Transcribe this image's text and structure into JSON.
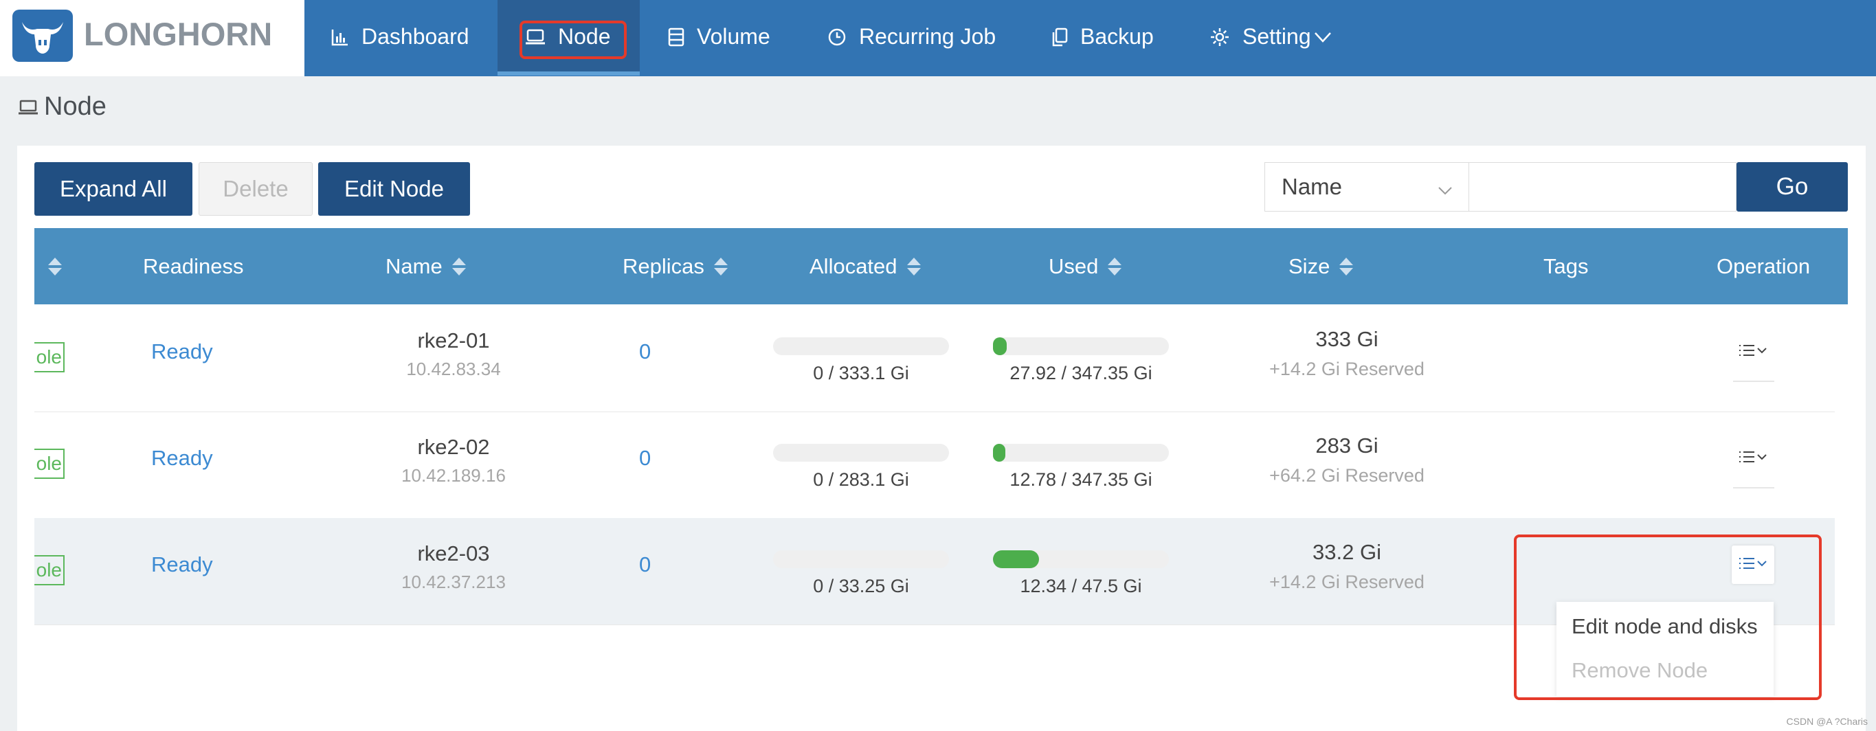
{
  "app": {
    "logo_text": "LONGHORN"
  },
  "nav": {
    "items": [
      {
        "label": "Dashboard",
        "icon": "bar-chart-icon"
      },
      {
        "label": "Node",
        "icon": "laptop-icon",
        "active": true
      },
      {
        "label": "Volume",
        "icon": "database-icon"
      },
      {
        "label": "Recurring Job",
        "icon": "clock-icon"
      },
      {
        "label": "Backup",
        "icon": "copy-icon"
      },
      {
        "label": "Setting",
        "icon": "gear-icon"
      }
    ]
  },
  "page": {
    "title": "Node"
  },
  "toolbar": {
    "expand_all": "Expand All",
    "delete": "Delete",
    "edit_node": "Edit Node",
    "search_field": "Name",
    "search_value": "",
    "go": "Go"
  },
  "table": {
    "headers": {
      "readiness": "Readiness",
      "name": "Name",
      "replicas": "Replicas",
      "allocated": "Allocated",
      "used": "Used",
      "size": "Size",
      "tags": "Tags",
      "operation": "Operation"
    },
    "rows": [
      {
        "status": "ole",
        "readiness": "Ready",
        "name": "rke2-01",
        "ip": "10.42.83.34",
        "replicas": "0",
        "allocated": "0 / 333.1 Gi",
        "allocated_fraction": 0,
        "used": "27.92 / 347.35 Gi",
        "used_fraction": 0.08,
        "size": "333 Gi",
        "reserved": "+14.2 Gi Reserved"
      },
      {
        "status": "ole",
        "readiness": "Ready",
        "name": "rke2-02",
        "ip": "10.42.189.16",
        "replicas": "0",
        "allocated": "0 / 283.1 Gi",
        "allocated_fraction": 0,
        "used": "12.78 / 347.35 Gi",
        "used_fraction": 0.037,
        "size": "283 Gi",
        "reserved": "+64.2 Gi Reserved"
      },
      {
        "status": "ole",
        "readiness": "Ready",
        "name": "rke2-03",
        "ip": "10.42.37.213",
        "replicas": "0",
        "allocated": "0 / 33.25 Gi",
        "allocated_fraction": 0,
        "used": "12.34 / 47.5 Gi",
        "used_fraction": 0.26,
        "size": "33.2 Gi",
        "reserved": "+14.2 Gi Reserved"
      }
    ]
  },
  "dropdown": {
    "edit": "Edit node and disks",
    "remove": "Remove Node"
  },
  "watermark": "CSDN @A ?Charis",
  "colors": {
    "nav": "#3274b3",
    "header": "#4a8fc0",
    "primary": "#214f82",
    "progress": "#4cae4c",
    "highlight": "#e53a2a"
  }
}
